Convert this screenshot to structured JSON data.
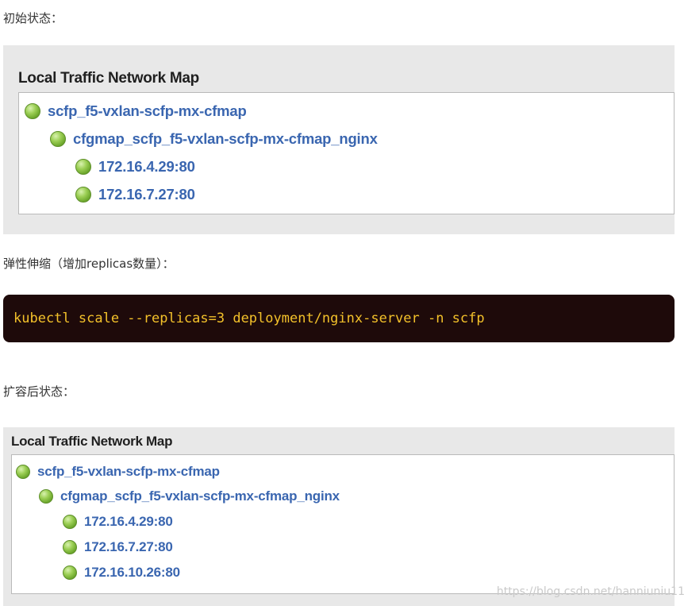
{
  "heading_initial": "初始状态：",
  "panel_initial": {
    "title": "Local Traffic Network Map",
    "nodes": [
      {
        "label": "scfp_f5-vxlan-scfp-mx-cfmap",
        "status": "green"
      },
      {
        "label": "cfgmap_scfp_f5-vxlan-scfp-mx-cfmap_nginx",
        "status": "green"
      },
      {
        "label": "172.16.4.29:80",
        "status": "green"
      },
      {
        "label": "172.16.7.27:80",
        "status": "green"
      }
    ]
  },
  "heading_scale": "弹性伸缩（增加replicas数量）：",
  "code": {
    "command": "kubectl scale --replicas=3 deployment/nginx-server -n scfp",
    "text_color": "#f3c12a",
    "background": "#1e0a0a"
  },
  "heading_after": "扩容后状态：",
  "panel_after": {
    "title": "Local Traffic Network Map",
    "nodes": [
      {
        "label": "scfp_f5-vxlan-scfp-mx-cfmap",
        "status": "green"
      },
      {
        "label": "cfgmap_scfp_f5-vxlan-scfp-mx-cfmap_nginx",
        "status": "green"
      },
      {
        "label": "172.16.4.29:80",
        "status": "green"
      },
      {
        "label": "172.16.7.27:80",
        "status": "green"
      },
      {
        "label": "172.16.10.26:80",
        "status": "green"
      }
    ]
  },
  "watermark": "https://blog.csdn.net/hanniuniu11",
  "colors": {
    "node_label": "#3a66b0",
    "status_green": "#8cc04a"
  }
}
